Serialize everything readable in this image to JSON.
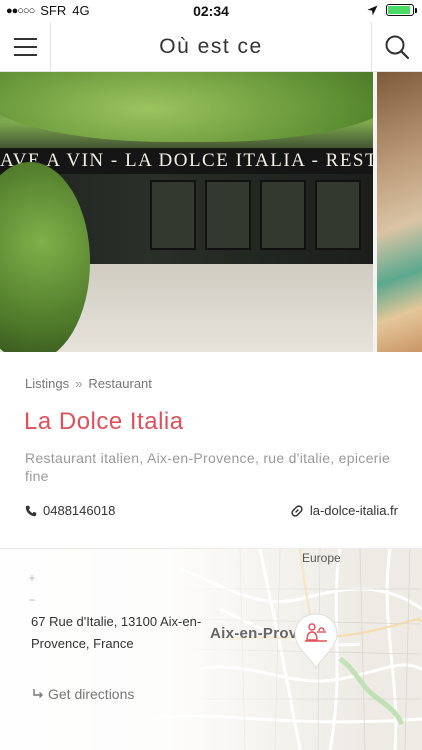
{
  "status_bar": {
    "signal_dots": "●●○○○",
    "carrier": "SFR",
    "network": "4G",
    "time": "02:34",
    "battery_level": 0.9
  },
  "header": {
    "title": "Où est ce",
    "menu_icon": "hamburger-menu-icon",
    "search_icon": "search-icon"
  },
  "gallery": {
    "sign_text": "AVE A VIN - LA DOLCE ITALIA - RESTAU"
  },
  "listing": {
    "breadcrumb": [
      "Listings",
      "Restaurant"
    ],
    "breadcrumb_separator": "»",
    "name": "La Dolce Italia",
    "tags": "Restaurant italien, Aix-en-Provence, rue d'italie, epicerie fine",
    "phone": "0488146018",
    "website": "la-dolce-italia.fr"
  },
  "map": {
    "label_top": "Europe",
    "label_city": "Aix-en-Provence",
    "zoom_in": "+",
    "zoom_out": "−",
    "address": "67 Rue d'Italie, 13100 Aix-en-Provence, France",
    "directions_label": "Get directions",
    "pin_icon": "restaurant-waiter-icon"
  },
  "colors": {
    "accent": "#e0505a",
    "battery": "#4cd964",
    "muted_text": "#9a9a9a"
  }
}
